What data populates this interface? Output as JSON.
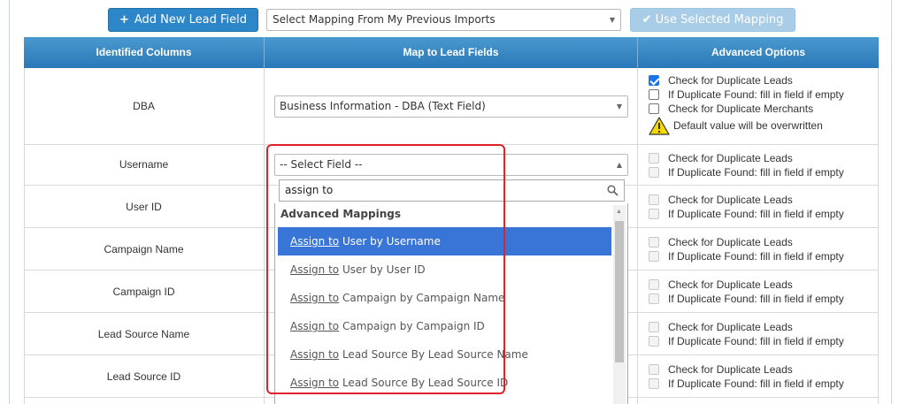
{
  "toolbar": {
    "add_field_label": "Add New Lead Field",
    "mapping_select_value": "Select Mapping From My Previous Imports",
    "use_mapping_label": "Use Selected Mapping"
  },
  "table": {
    "headers": [
      "Identified Columns",
      "Map to Lead Fields",
      "Advanced Options"
    ],
    "rows": [
      {
        "name": "DBA",
        "mapped": "Business Information - DBA (Text Field)"
      },
      {
        "name": "Username",
        "mapped": "-- Select Field --"
      },
      {
        "name": "User ID"
      },
      {
        "name": "Campaign Name"
      },
      {
        "name": "Campaign ID"
      },
      {
        "name": "Lead Source Name"
      },
      {
        "name": "Lead Source ID"
      }
    ]
  },
  "options": {
    "check_dup_leads": "Check for Duplicate Leads",
    "fill_if_empty": "If Duplicate Found: fill in field if empty",
    "check_dup_merchants": "Check for Duplicate Merchants",
    "default_overwritten": "Default value will be overwritten"
  },
  "dropdown": {
    "search_value": "assign to",
    "group_label": "Advanced Mappings",
    "items": [
      {
        "prefix": "Assign to",
        "rest": " User by Username"
      },
      {
        "prefix": "Assign to",
        "rest": " User by User ID"
      },
      {
        "prefix": "Assign to",
        "rest": " Campaign by Campaign Name"
      },
      {
        "prefix": "Assign to",
        "rest": " Campaign by Campaign ID"
      },
      {
        "prefix": "Assign to",
        "rest": " Lead Source By Lead Source Name"
      },
      {
        "prefix": "Assign to",
        "rest": " Lead Source By Lead Source ID"
      }
    ]
  },
  "colors": {
    "primary": "#2c86c7",
    "header": "#3a89c6",
    "highlight": "#3875d7",
    "annotation": "#e0202a",
    "warning": "#f5d800"
  }
}
